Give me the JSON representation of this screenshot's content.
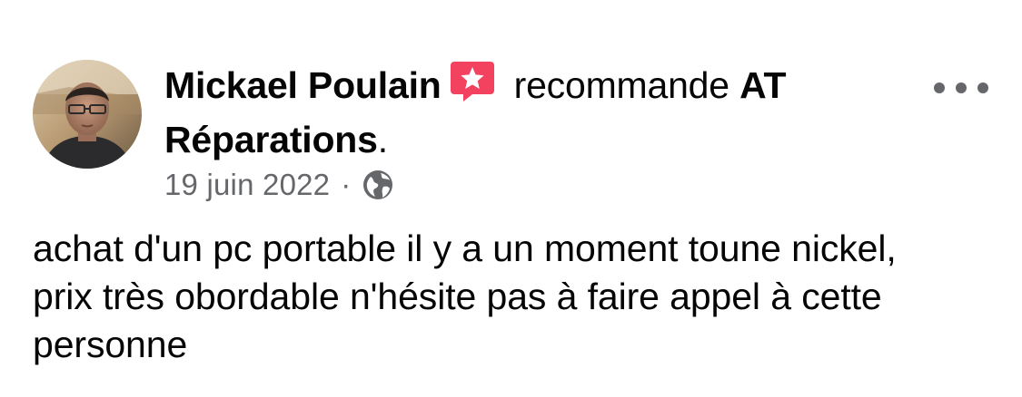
{
  "post": {
    "author_name": "Mickael Poulain",
    "recommend_verb": "recommande",
    "page_name": "AT Réparations",
    "page_suffix": ".",
    "date": "19 juin 2022",
    "separator": "·",
    "audience_icon": "globe-icon",
    "badge_icon": "recommend-star-icon",
    "more_icon": "more-options-icon",
    "text": "achat d'un pc portable il y a un moment toune nickel, prix très obordable n'hésite pas à faire appel à cette personne"
  },
  "colors": {
    "text_primary": "#050505",
    "text_secondary": "#65676b",
    "recommend_badge": "#f3425f"
  }
}
